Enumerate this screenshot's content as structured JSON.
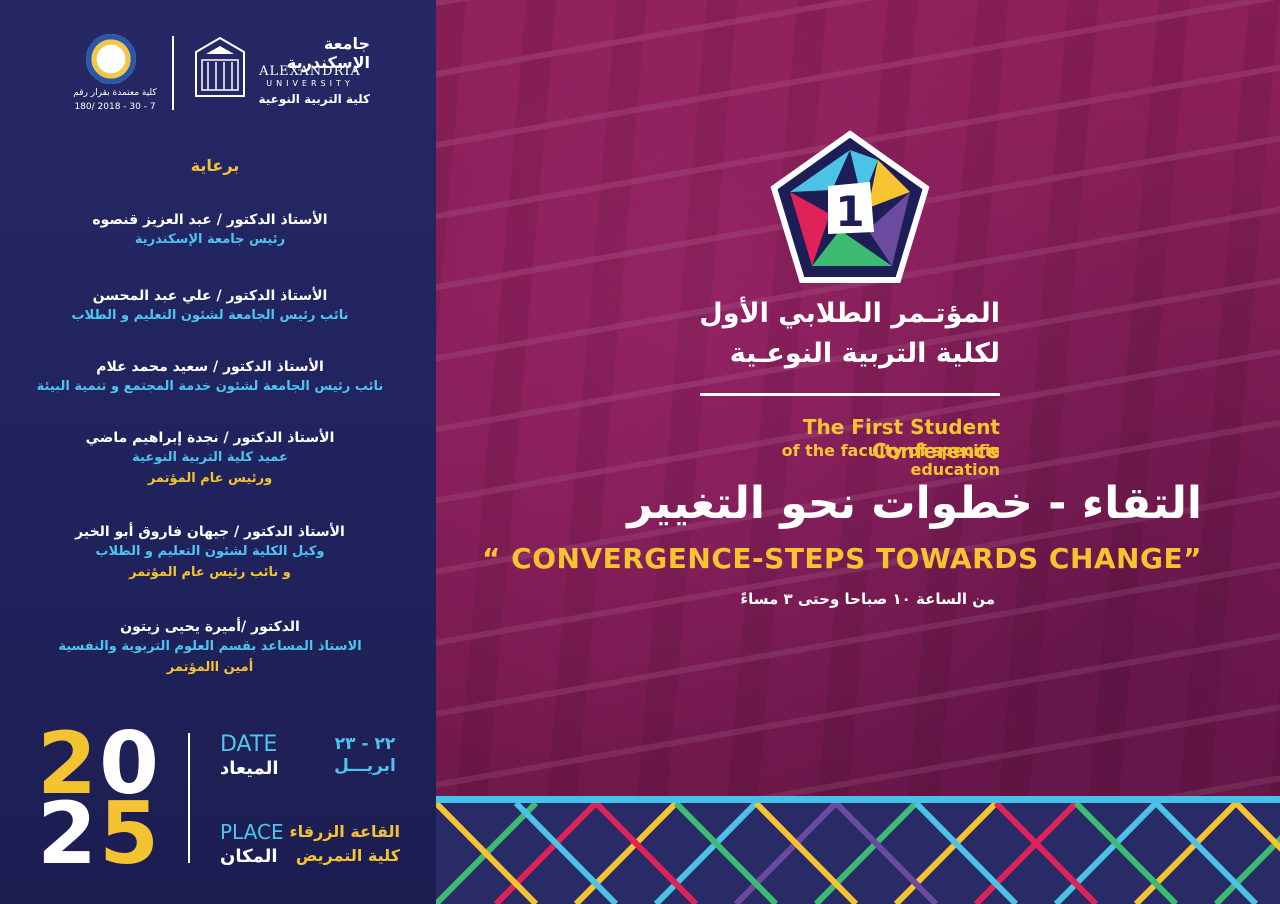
{
  "logos": {
    "university_ar": "جامعة الإسكندرية",
    "university_en": "ALEXANDRIA",
    "university_en2": "UNIVERSITY",
    "faculty_ar": "كلية التربية النوعية",
    "accredited_line1": "كلية معتمدة بقرار رقم",
    "accredited_line2": "180/ 2018 - 30 - 7"
  },
  "patron": {
    "title": "برعاية",
    "people": [
      {
        "name": "الأستاذ الدكتور / عبد العزيز قنصوه",
        "role": "رئيس جامعة الإسكندرية",
        "extra": ""
      },
      {
        "name": "الأستاذ الدكتور / علي عبد المحسن",
        "role": "نائب رئيس الجامعة لشئون التعليم و الطلاب",
        "extra": ""
      },
      {
        "name": "الأستاذ الدكتور / سعيد محمد علام",
        "role": "نائب رئيس الجامعة لشئون خدمة المجتمع و تنمية البيئة",
        "extra": ""
      },
      {
        "name": "الأستاذ الدكتور / نجدة إبراهيم ماضي",
        "role": "عميد كلية التربية النوعية",
        "extra": "ورئيس عام المؤتمر"
      },
      {
        "name": "الأستاذ الدكتور / جيهان فاروق أبو الخير",
        "role": "وكيل الكلية لشئون التعليم و الطلاب",
        "extra": "و نائب رئيس عام المؤتمر"
      },
      {
        "name": "الدكتور /أميرة يحيى زيتون",
        "role": "الاستاذ المساعد بقسم العلوم التربوية والنفسية",
        "extra": "أمين االمؤتمر"
      }
    ]
  },
  "year": {
    "d1": "2",
    "d2": "0",
    "d3": "2",
    "d4": "5"
  },
  "info": {
    "date_en": "DATE",
    "date_ar": "الميعاد",
    "date_value": "٢٢ - ٢٣",
    "date_month": "ابريـــل",
    "place_en": "PLACE",
    "place_ar": "المكان",
    "place_value1": "القاعة الزرقاء",
    "place_value2": "كلية التمريض"
  },
  "conference": {
    "emblem_number": "1",
    "title_ar_line1": "المؤتـمر الطلابي الأول",
    "title_ar_line2": "لكلية التربية النوعـية",
    "title_en_line1": "The First Student Conference",
    "title_en_line2": "of the faculty of specific education",
    "theme_ar": "التقاء - خطوات نحو التغيير",
    "theme_en": "“ CONVERGENCE-STEPS TOWARDS CHANGE”",
    "time_ar": "من الساعة ١٠ صباحا وحتى ٣ مساءً"
  },
  "colors": {
    "left_bg": "#262866",
    "right_bg": "#8d2059",
    "accent_yellow": "#f3c332",
    "accent_blue": "#4fc4ef",
    "text_white": "#ffffff"
  }
}
